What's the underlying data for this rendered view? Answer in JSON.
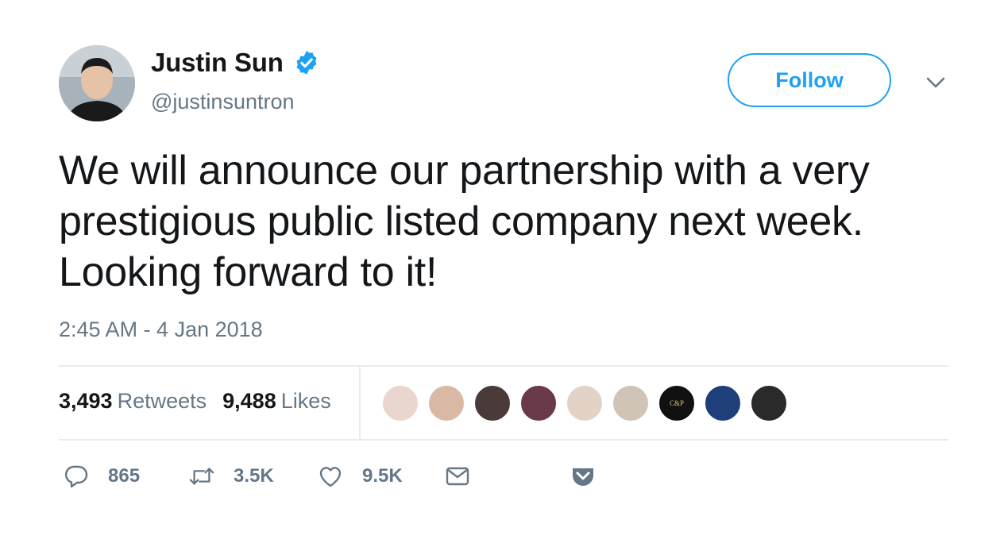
{
  "user": {
    "name": "Justin Sun",
    "handle": "@justinsuntron",
    "verified": true
  },
  "follow_label": "Follow",
  "tweet": {
    "lines": [
      "We will announce our partnership with a very",
      "prestigious public listed company next week.",
      "Looking forward to it!"
    ],
    "timestamp": "2:45 AM - 4 Jan 2018"
  },
  "stats": {
    "retweets_count": "3,493",
    "retweets_label": "Retweets",
    "likes_count": "9,488",
    "likes_label": "Likes"
  },
  "liker_avatars": [
    {
      "name": "liker-1",
      "color": "#e9d7cf"
    },
    {
      "name": "liker-2",
      "color": "#d9b9a4"
    },
    {
      "name": "liker-3",
      "color": "#4a3a3a"
    },
    {
      "name": "liker-4",
      "color": "#6b3a4a"
    },
    {
      "name": "liker-5",
      "color": "#e2d3c6"
    },
    {
      "name": "liker-6",
      "color": "#cfc4b6"
    },
    {
      "name": "liker-7",
      "color": "#111111",
      "text": "C&P"
    },
    {
      "name": "liker-8",
      "color": "#1f3f7a"
    },
    {
      "name": "liker-9",
      "color": "#2a2a2a"
    }
  ],
  "actions": {
    "replies": "865",
    "retweets": "3.5K",
    "likes": "9.5K"
  },
  "colors": {
    "accent": "#1da1f2",
    "muted": "#657786",
    "text": "#14171a",
    "divider": "#e6ecf0"
  },
  "icons": {
    "verified": "verified-badge-icon",
    "caret": "chevron-down-icon",
    "reply": "reply-icon",
    "retweet": "retweet-icon",
    "like": "heart-icon",
    "dm": "envelope-icon",
    "pocket": "pocket-icon"
  }
}
